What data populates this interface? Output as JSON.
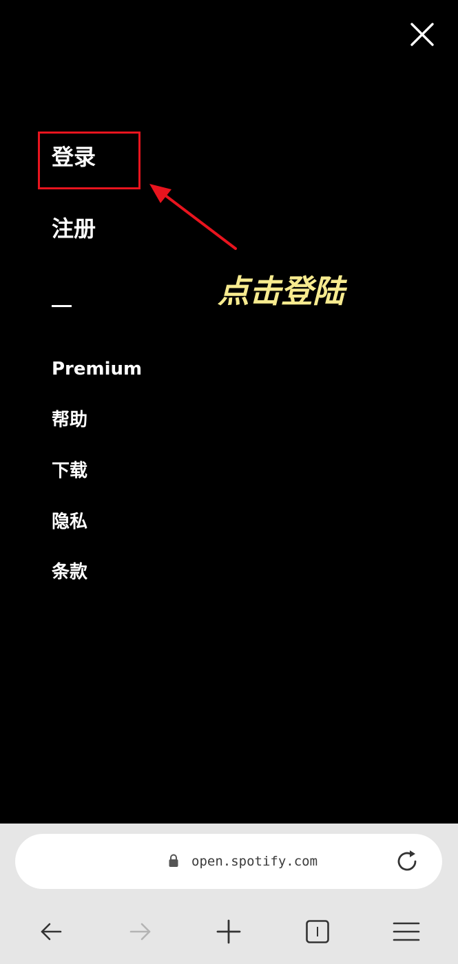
{
  "menu": {
    "items_primary": [
      {
        "label": "登录"
      },
      {
        "label": "注册"
      }
    ],
    "items_secondary": [
      {
        "label": "Premium"
      },
      {
        "label": "帮助"
      },
      {
        "label": "下载"
      },
      {
        "label": "隐私"
      },
      {
        "label": "条款"
      }
    ]
  },
  "annotation": {
    "text": "点击登陆",
    "text_color": "#f7eb8f",
    "highlight_color": "#e8141e"
  },
  "browser": {
    "url": "open.spotify.com",
    "icons": {
      "lock": "lock-icon",
      "reload": "reload-icon",
      "back": "arrow-left-icon",
      "forward": "arrow-right-icon",
      "new_tab": "plus-icon",
      "tabs": "tabs-icon",
      "menu": "hamburger-icon"
    }
  },
  "colors": {
    "background": "#000000",
    "menu_text": "#ffffff",
    "browser_bar": "#e6e6e6"
  }
}
